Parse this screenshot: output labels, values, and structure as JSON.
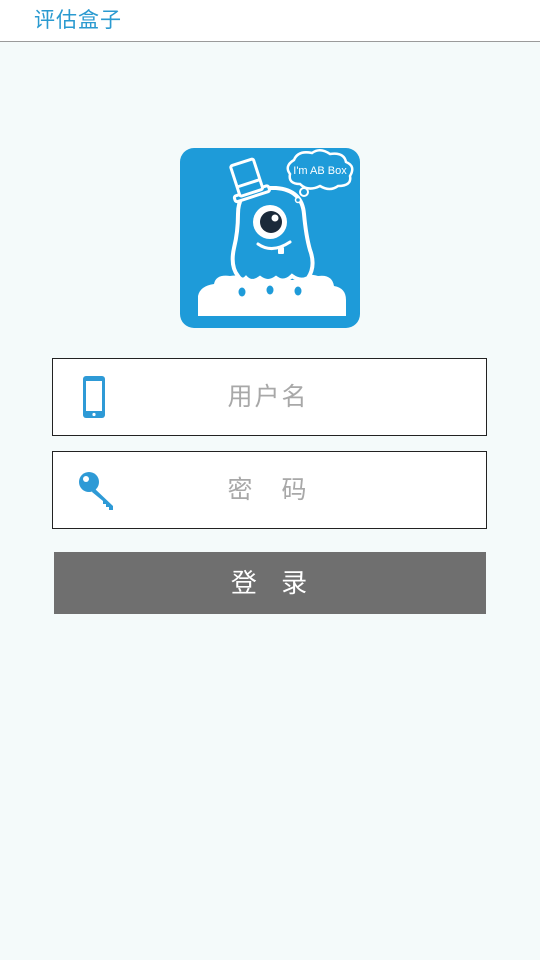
{
  "app_bar": {
    "title": "评估盒子"
  },
  "logo": {
    "bubble_text": "I'm AB Box",
    "brand_color": "#1e9bd9"
  },
  "form": {
    "username": {
      "placeholder": "用户名",
      "value": "",
      "icon": "phone-icon"
    },
    "password": {
      "placeholder": "密　码",
      "value": "",
      "icon": "key-icon"
    },
    "login_label": "登 录"
  },
  "colors": {
    "accent": "#2a9ad0",
    "button": "#6f6f6f",
    "background": "#f4fafa"
  }
}
